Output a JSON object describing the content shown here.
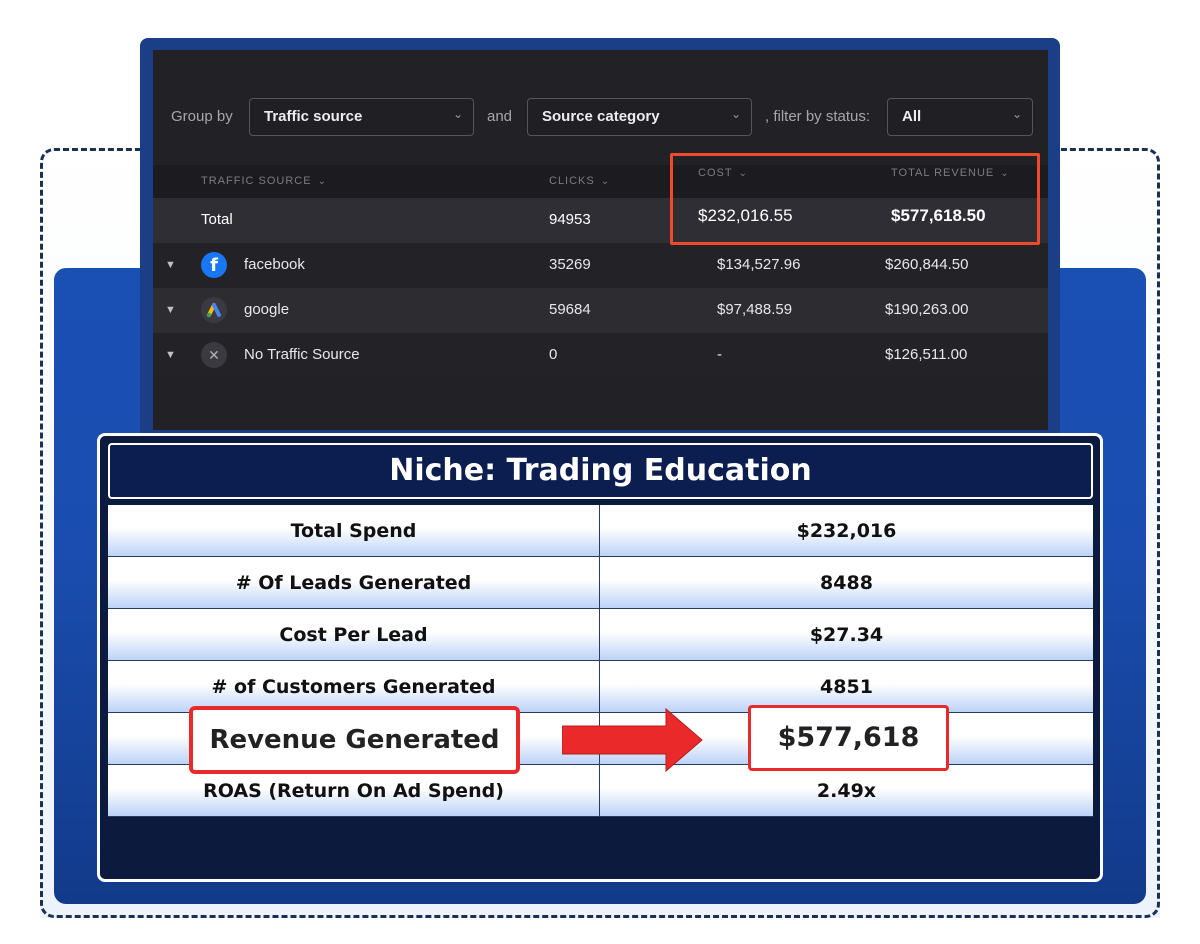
{
  "dashboard": {
    "filters": {
      "group_by_label": "Group by",
      "group_by_value": "Traffic source",
      "and_label": "and",
      "second_value": "Source category",
      "filter_label": ", filter by status:",
      "status_value": "All"
    },
    "columns": {
      "traffic_source": "TRAFFIC SOURCE",
      "clicks": "CLICKS",
      "cost": "COST",
      "total_revenue": "TOTAL REVENUE"
    },
    "rows": [
      {
        "name": "Total",
        "clicks": "94953",
        "cost": "$232,016.55",
        "revenue": "$577,618.50"
      },
      {
        "name": "facebook",
        "icon": "facebook-icon",
        "clicks": "35269",
        "cost": "$134,527.96",
        "revenue": "$260,844.50"
      },
      {
        "name": "google",
        "icon": "google-ads-icon",
        "clicks": "59684",
        "cost": "$97,488.59",
        "revenue": "$190,263.00"
      },
      {
        "name": "No Traffic Source",
        "icon": "x-icon",
        "clicks": "0",
        "cost": "-",
        "revenue": "$126,511.00"
      }
    ],
    "highlight_color": "#ef4a2a"
  },
  "summary": {
    "title": "Niche: Trading Education",
    "rows": [
      {
        "label": "Total Spend",
        "value": "$232,016"
      },
      {
        "label": "# Of Leads Generated",
        "value": "8488"
      },
      {
        "label": "Cost Per Lead",
        "value": "$27.34"
      },
      {
        "label": "# of Customers Generated",
        "value": "4851"
      },
      {
        "label": "Revenue Generated",
        "value": "$577,618"
      },
      {
        "label": "ROAS (Return On Ad Spend)",
        "value": "2.49x"
      }
    ],
    "accent_color": "#ea2a2a",
    "panel_color": "#1a4fb4"
  }
}
